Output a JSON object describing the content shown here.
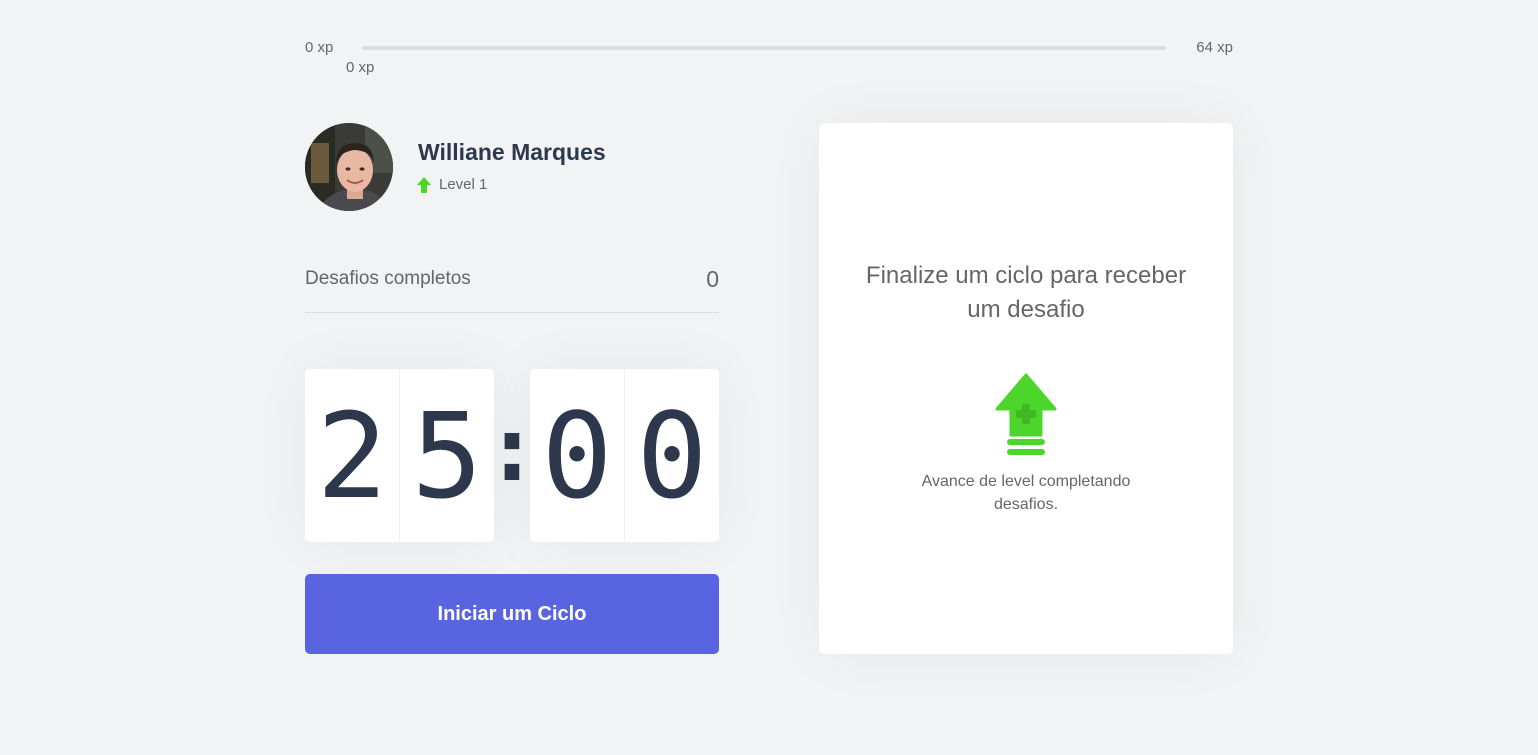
{
  "xp": {
    "min_label": "0 xp",
    "max_label": "64 xp",
    "current_label": "0 xp",
    "progress_fraction": 0
  },
  "profile": {
    "name": "Williane Marques",
    "level_label": "Level 1",
    "avatar_icon": "user-photo",
    "level_icon": "level-up-arrow-icon"
  },
  "completed_challenges": {
    "label": "Desafios completos",
    "count": "0"
  },
  "countdown": {
    "minute_left": "2",
    "minute_right": "5",
    "separator": ":",
    "second_left": "0",
    "second_right": "0"
  },
  "start_button": {
    "label": "Iniciar um Ciclo"
  },
  "challenge_box": {
    "title": "Finalize um ciclo para receber um desafio",
    "description": "Avance de level completando desafios.",
    "icon": "level-up-icon"
  },
  "colors": {
    "background": "#f2f3f5",
    "accent_green": "#4cd62b",
    "button_blue": "#5965e0",
    "title_dark": "#2e384d",
    "text": "#666666"
  }
}
